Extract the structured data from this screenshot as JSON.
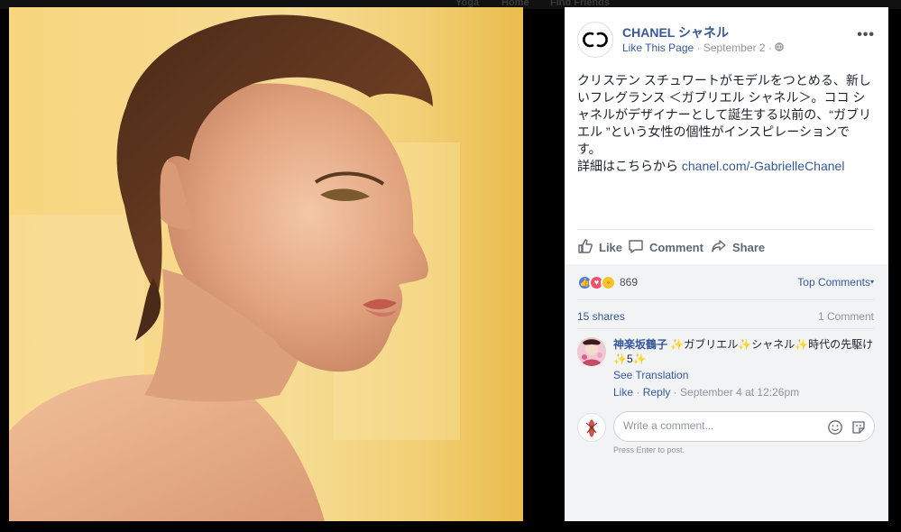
{
  "backdrop": {
    "ghost_items": [
      "Yoga",
      "Home",
      "Find Friends"
    ]
  },
  "post": {
    "page_name": "CHANEL シャネル",
    "like_page": "Like This Page",
    "sep": "·",
    "date": "September 2",
    "sep2": "·",
    "text_lines": [
      "クリステン スチュワートがモデルをつとめる、新し",
      "いフレグランス ＜ガブリエル シャネル＞。ココ シ",
      "ャネルがデザイナーとして誕生する以前の、“ガブリ",
      "エル ”という女性の個性がインスピレーションで",
      "す。"
    ],
    "detail_prefix": "詳細はこちらから ",
    "detail_link": "chanel.com/-GabrielleChanel"
  },
  "actions": {
    "like": "Like",
    "comment": "Comment",
    "share": "Share"
  },
  "reactions": {
    "count": "869",
    "top_comments": "Top Comments",
    "caret": "▾"
  },
  "stats": {
    "shares": "15 shares",
    "comments": "1 Comment"
  },
  "comment": {
    "author": "神楽坂鶴子",
    "text": " ✨ガブリエル✨シャネル✨時代の先駆け✨5✨",
    "see_translation": "See Translation",
    "like": "Like",
    "dot1": " · ",
    "reply": "Reply",
    "dot2": " · ",
    "time": "September 4 at 12:26pm"
  },
  "composer": {
    "placeholder": "Write a comment...",
    "hint": "Press Enter to post."
  },
  "colors": {
    "link": "#365899",
    "muted": "#90949c",
    "panel_gray": "#f2f3f5"
  },
  "icons": [
    "chanel-logo-icon",
    "globe-icon",
    "more-icon",
    "like-icon",
    "comment-icon",
    "share-icon",
    "emoji-icon",
    "sticker-icon"
  ]
}
